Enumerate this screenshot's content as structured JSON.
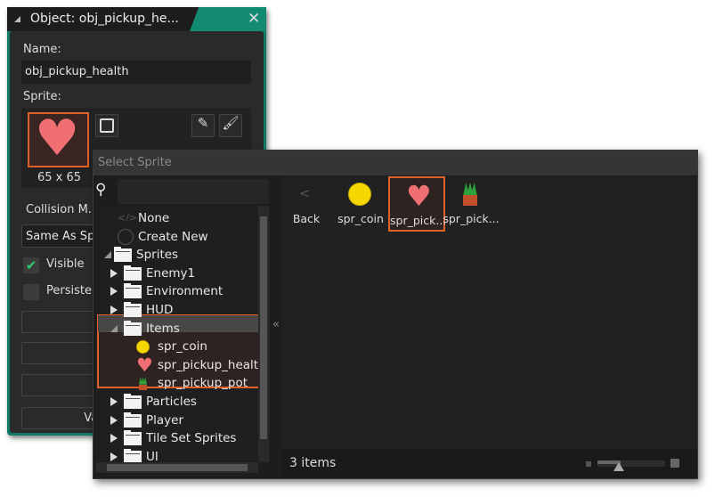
{
  "object_window": {
    "title": "Object: obj_pickup_he...",
    "name_label": "Name:",
    "name_value": "obj_pickup_health",
    "sprite_label": "Sprite:",
    "sprite_size": "65 x 65",
    "collision_label": "Collision M...",
    "collision_value": "Same As Sp",
    "visible_label": "Visible",
    "visible_checked": true,
    "persistent_label": "Persiste",
    "persistent_checked": false,
    "variables_button": "Vari",
    "accent_color": "#138b73"
  },
  "select_sprite": {
    "title": "Select Sprite",
    "search_placeholder": "",
    "tree": [
      {
        "label": "None",
        "icon": "code-icon"
      },
      {
        "label": "Create New",
        "icon": "plus-circle-icon"
      },
      {
        "label": "Sprites",
        "icon": "folder-icon",
        "expanded": true
      },
      {
        "label": "Enemy1",
        "icon": "folder-icon"
      },
      {
        "label": "Environment",
        "icon": "folder-icon"
      },
      {
        "label": "HUD",
        "icon": "folder-icon"
      },
      {
        "label": "Items",
        "icon": "folder-icon",
        "expanded": true
      },
      {
        "label": "spr_coin",
        "icon": "coin-icon"
      },
      {
        "label": "spr_pickup_healt",
        "icon": "heart-icon"
      },
      {
        "label": "spr_pickup_pot",
        "icon": "potted-plant-icon"
      },
      {
        "label": "Particles",
        "icon": "folder-icon"
      },
      {
        "label": "Player",
        "icon": "folder-icon"
      },
      {
        "label": "Tile Set Sprites",
        "icon": "folder-icon"
      },
      {
        "label": "UI",
        "icon": "folder-icon"
      }
    ],
    "collapse_label": "«",
    "grid": [
      {
        "label": "Back",
        "icon": "back-chevron-icon"
      },
      {
        "label": "spr_coin",
        "icon": "coin-icon"
      },
      {
        "label": "spr_pick...",
        "icon": "heart-icon",
        "selected": true
      },
      {
        "label": "spr_pick...",
        "icon": "potted-plant-icon"
      }
    ],
    "status": "3 items",
    "highlight_color": "#e0602a"
  }
}
